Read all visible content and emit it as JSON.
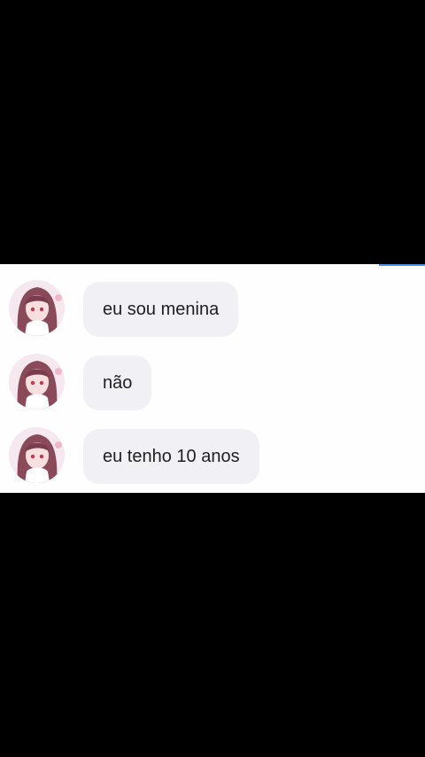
{
  "conversation": {
    "messages": [
      {
        "text": "eu sou menina",
        "avatar_icon": "anime-girl-avatar-icon"
      },
      {
        "text": "não",
        "avatar_icon": "anime-girl-avatar-icon"
      },
      {
        "text": "eu tenho 10 anos",
        "avatar_icon": "anime-girl-avatar-icon"
      }
    ]
  },
  "colors": {
    "panel_background": "#fefefe",
    "bubble_background": "#f1f0f5",
    "letterbox": "#000000",
    "accent": "#4a90e2"
  }
}
